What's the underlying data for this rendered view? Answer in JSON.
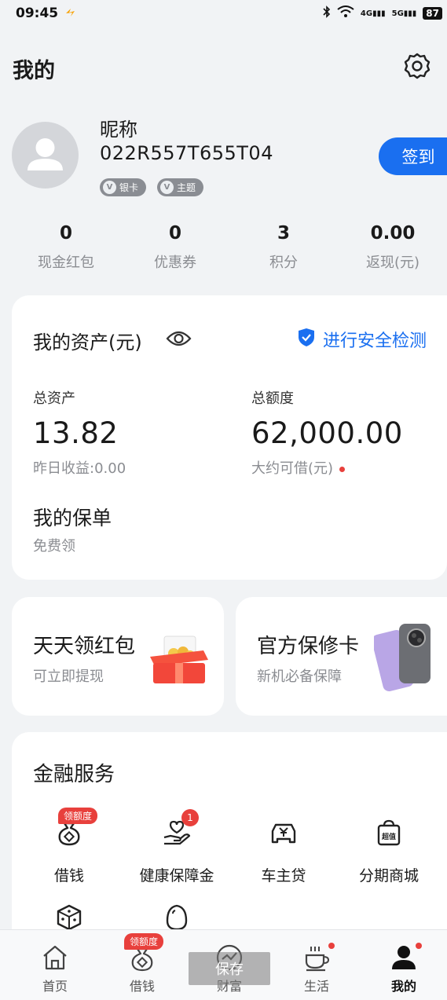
{
  "status_bar": {
    "time": "09:45",
    "network_4g": "4G",
    "network_5g": "5G",
    "battery": "87"
  },
  "header": {
    "title": "我的",
    "settings_icon": "gear-icon"
  },
  "profile": {
    "nickname": "昵称",
    "user_id": "022R557T655T04",
    "badge_card": "银卡",
    "badge_theme": "主题",
    "signin_label": "签到"
  },
  "stats": [
    {
      "value": "0",
      "label": "现金红包"
    },
    {
      "value": "0",
      "label": "优惠券"
    },
    {
      "value": "3",
      "label": "积分"
    },
    {
      "value": "0.00",
      "label": "返现(元)"
    }
  ],
  "assets": {
    "title": "我的资产(元)",
    "security_label": "进行安全检测",
    "total_assets_label": "总资产",
    "total_assets_value": "13.82",
    "yesterday_income": "昨日收益:0.00",
    "credit_label": "总额度",
    "credit_value": "62,000.00",
    "credit_sub": "大约可借(元)",
    "policy_title": "我的保单",
    "policy_sub": "免费领"
  },
  "promos": {
    "left_title": "天天领红包",
    "left_sub": "可立即提现",
    "right_title": "官方保修卡",
    "right_sub": "新机必备保障"
  },
  "finance": {
    "title": "金融服务",
    "items": [
      {
        "label": "借钱",
        "icon": "money-bag-icon",
        "tag": "领额度"
      },
      {
        "label": "健康保障金",
        "icon": "hand-heart-icon",
        "count": "1"
      },
      {
        "label": "车主贷",
        "icon": "car-yuan-icon"
      },
      {
        "label": "分期商城",
        "icon": "shopping-bag-icon",
        "icon_text": "超值"
      }
    ],
    "more_icons": [
      "dice-icon",
      "egg-icon"
    ]
  },
  "tabbar": {
    "items": [
      {
        "label": "首页",
        "icon": "home-icon"
      },
      {
        "label": "借钱",
        "icon": "money-bag-icon",
        "tag": "领额度"
      },
      {
        "label": "财富",
        "icon": "wealth-icon"
      },
      {
        "label": "生活",
        "icon": "coffee-cup-icon"
      },
      {
        "label": "我的",
        "icon": "person-icon"
      }
    ],
    "toast": "保存"
  },
  "colors": {
    "accent": "#1a6ff0",
    "alert": "#e8403c",
    "background": "#f1f3f5"
  }
}
